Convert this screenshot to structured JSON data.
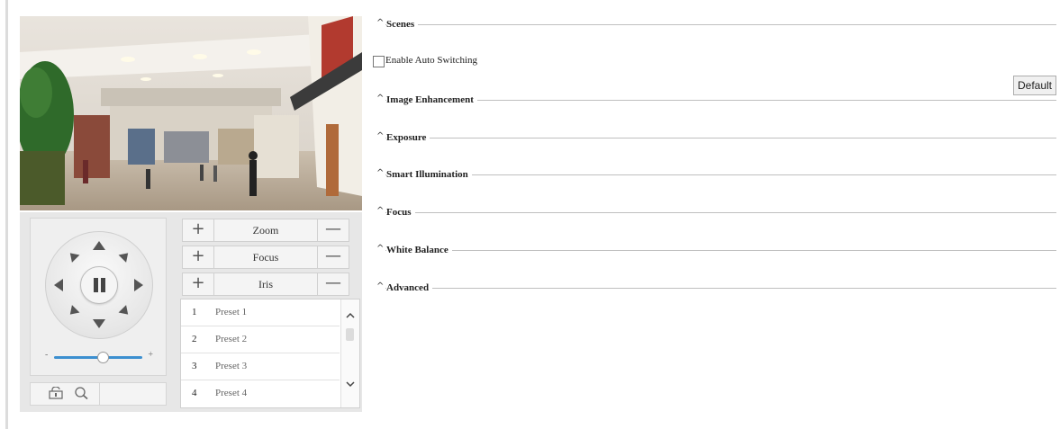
{
  "ptz": {
    "controls": [
      {
        "label": "Zoom",
        "plus": "+",
        "minus": "—"
      },
      {
        "label": "Focus",
        "plus": "+",
        "minus": "—"
      },
      {
        "label": "Iris",
        "plus": "+",
        "minus": "—"
      }
    ],
    "speed": {
      "minus": "-",
      "plus": "+",
      "value_fraction": 0.55
    },
    "presets": [
      {
        "num": "1",
        "name": "Preset 1"
      },
      {
        "num": "2",
        "name": "Preset 2"
      },
      {
        "num": "3",
        "name": "Preset 3"
      },
      {
        "num": "4",
        "name": "Preset 4"
      }
    ],
    "preset_scroll": {
      "up": "^",
      "down": "v"
    },
    "icons": [
      "lock-icon",
      "zoom-icon",
      "pause-icon",
      "arrow-icons"
    ]
  },
  "settings": {
    "scenes": {
      "caret": "^",
      "title": "Scenes"
    },
    "auto_switching": {
      "label": "Enable Auto Switching",
      "checked": false
    },
    "default_button": "Default",
    "sections": [
      {
        "caret": "^",
        "title": "Image Enhancement"
      },
      {
        "caret": "^",
        "title": "Exposure"
      },
      {
        "caret": "^",
        "title": "Smart Illumination"
      },
      {
        "caret": "^",
        "title": "Focus"
      },
      {
        "caret": "^",
        "title": "White Balance"
      },
      {
        "caret": "^",
        "title": "Advanced"
      }
    ]
  },
  "colors": {
    "accent": "#3c8fd0",
    "panel": "#e7e7e7"
  }
}
